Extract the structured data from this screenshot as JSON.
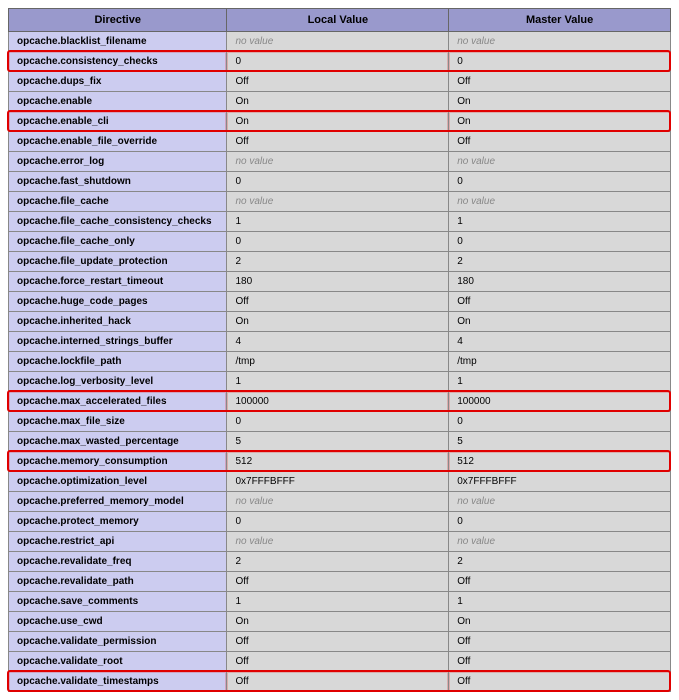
{
  "columns": {
    "directive": "Directive",
    "local": "Local Value",
    "master": "Master Value"
  },
  "no_value_label": "no value",
  "rows": [
    {
      "d": "opcache.blacklist_filename",
      "l": null,
      "m": null,
      "hl": false
    },
    {
      "d": "opcache.consistency_checks",
      "l": "0",
      "m": "0",
      "hl": true
    },
    {
      "d": "opcache.dups_fix",
      "l": "Off",
      "m": "Off",
      "hl": false
    },
    {
      "d": "opcache.enable",
      "l": "On",
      "m": "On",
      "hl": false
    },
    {
      "d": "opcache.enable_cli",
      "l": "On",
      "m": "On",
      "hl": true
    },
    {
      "d": "opcache.enable_file_override",
      "l": "Off",
      "m": "Off",
      "hl": false
    },
    {
      "d": "opcache.error_log",
      "l": null,
      "m": null,
      "hl": false
    },
    {
      "d": "opcache.fast_shutdown",
      "l": "0",
      "m": "0",
      "hl": false
    },
    {
      "d": "opcache.file_cache",
      "l": null,
      "m": null,
      "hl": false
    },
    {
      "d": "opcache.file_cache_consistency_checks",
      "l": "1",
      "m": "1",
      "hl": false
    },
    {
      "d": "opcache.file_cache_only",
      "l": "0",
      "m": "0",
      "hl": false
    },
    {
      "d": "opcache.file_update_protection",
      "l": "2",
      "m": "2",
      "hl": false
    },
    {
      "d": "opcache.force_restart_timeout",
      "l": "180",
      "m": "180",
      "hl": false
    },
    {
      "d": "opcache.huge_code_pages",
      "l": "Off",
      "m": "Off",
      "hl": false
    },
    {
      "d": "opcache.inherited_hack",
      "l": "On",
      "m": "On",
      "hl": false
    },
    {
      "d": "opcache.interned_strings_buffer",
      "l": "4",
      "m": "4",
      "hl": false
    },
    {
      "d": "opcache.lockfile_path",
      "l": "/tmp",
      "m": "/tmp",
      "hl": false
    },
    {
      "d": "opcache.log_verbosity_level",
      "l": "1",
      "m": "1",
      "hl": false
    },
    {
      "d": "opcache.max_accelerated_files",
      "l": "100000",
      "m": "100000",
      "hl": true
    },
    {
      "d": "opcache.max_file_size",
      "l": "0",
      "m": "0",
      "hl": false
    },
    {
      "d": "opcache.max_wasted_percentage",
      "l": "5",
      "m": "5",
      "hl": false
    },
    {
      "d": "opcache.memory_consumption",
      "l": "512",
      "m": "512",
      "hl": true
    },
    {
      "d": "opcache.optimization_level",
      "l": "0x7FFFBFFF",
      "m": "0x7FFFBFFF",
      "hl": false
    },
    {
      "d": "opcache.preferred_memory_model",
      "l": null,
      "m": null,
      "hl": false
    },
    {
      "d": "opcache.protect_memory",
      "l": "0",
      "m": "0",
      "hl": false
    },
    {
      "d": "opcache.restrict_api",
      "l": null,
      "m": null,
      "hl": false
    },
    {
      "d": "opcache.revalidate_freq",
      "l": "2",
      "m": "2",
      "hl": false
    },
    {
      "d": "opcache.revalidate_path",
      "l": "Off",
      "m": "Off",
      "hl": false
    },
    {
      "d": "opcache.save_comments",
      "l": "1",
      "m": "1",
      "hl": false
    },
    {
      "d": "opcache.use_cwd",
      "l": "On",
      "m": "On",
      "hl": false
    },
    {
      "d": "opcache.validate_permission",
      "l": "Off",
      "m": "Off",
      "hl": false
    },
    {
      "d": "opcache.validate_root",
      "l": "Off",
      "m": "Off",
      "hl": false
    },
    {
      "d": "opcache.validate_timestamps",
      "l": "Off",
      "m": "Off",
      "hl": true
    }
  ]
}
